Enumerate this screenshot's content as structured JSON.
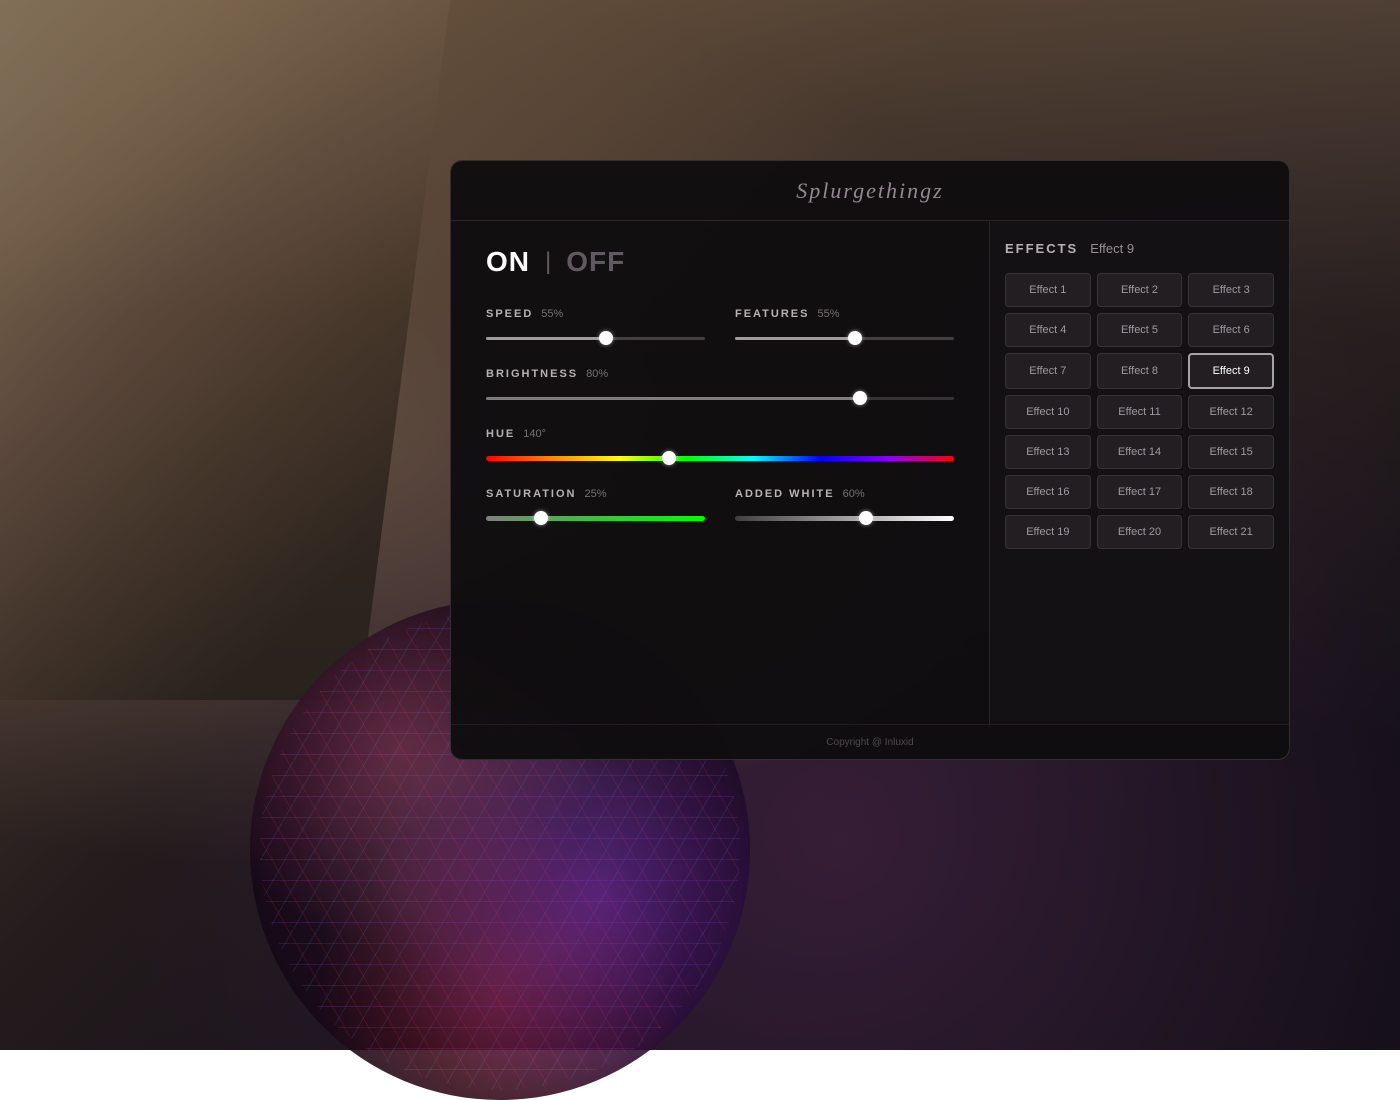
{
  "background": {
    "description": "Interior architecture with geometric art sculpture"
  },
  "panel": {
    "logo": "Splurgethingz",
    "power": {
      "on_label": "ON",
      "off_label": "OFF",
      "divider": "|"
    },
    "sliders": {
      "speed": {
        "label": "SPEED",
        "value": "55%",
        "percent": 55
      },
      "features": {
        "label": "FEATURES",
        "value": "55%",
        "percent": 55
      },
      "brightness": {
        "label": "BRIGHTNESS",
        "value": "80%",
        "percent": 80
      },
      "hue": {
        "label": "HUE",
        "value": "140°",
        "percent": 39
      },
      "saturation": {
        "label": "SATURATION",
        "value": "25%",
        "percent": 25
      },
      "added_white": {
        "label": "ADDED WHITE",
        "value": "60%",
        "percent": 60
      }
    },
    "footer": {
      "copyright": "Copyright @ Inluxid"
    }
  },
  "effects": {
    "title": "EFFECTS",
    "current": "Effect 9",
    "active_id": 9,
    "items": [
      {
        "id": 1,
        "label": "Effect 1"
      },
      {
        "id": 2,
        "label": "Effect 2"
      },
      {
        "id": 3,
        "label": "Effect 3"
      },
      {
        "id": 4,
        "label": "Effect 4"
      },
      {
        "id": 5,
        "label": "Effect 5"
      },
      {
        "id": 6,
        "label": "Effect 6"
      },
      {
        "id": 7,
        "label": "Effect 7"
      },
      {
        "id": 8,
        "label": "Effect 8"
      },
      {
        "id": 9,
        "label": "Effect 9"
      },
      {
        "id": 10,
        "label": "Effect 10"
      },
      {
        "id": 11,
        "label": "Effect 11"
      },
      {
        "id": 12,
        "label": "Effect 12"
      },
      {
        "id": 13,
        "label": "Effect 13"
      },
      {
        "id": 14,
        "label": "Effect 14"
      },
      {
        "id": 15,
        "label": "Effect 15"
      },
      {
        "id": 16,
        "label": "Effect 16"
      },
      {
        "id": 17,
        "label": "Effect 17"
      },
      {
        "id": 18,
        "label": "Effect 18"
      },
      {
        "id": 19,
        "label": "Effect 19"
      },
      {
        "id": 20,
        "label": "Effect 20"
      },
      {
        "id": 21,
        "label": "Effect 21"
      }
    ]
  }
}
